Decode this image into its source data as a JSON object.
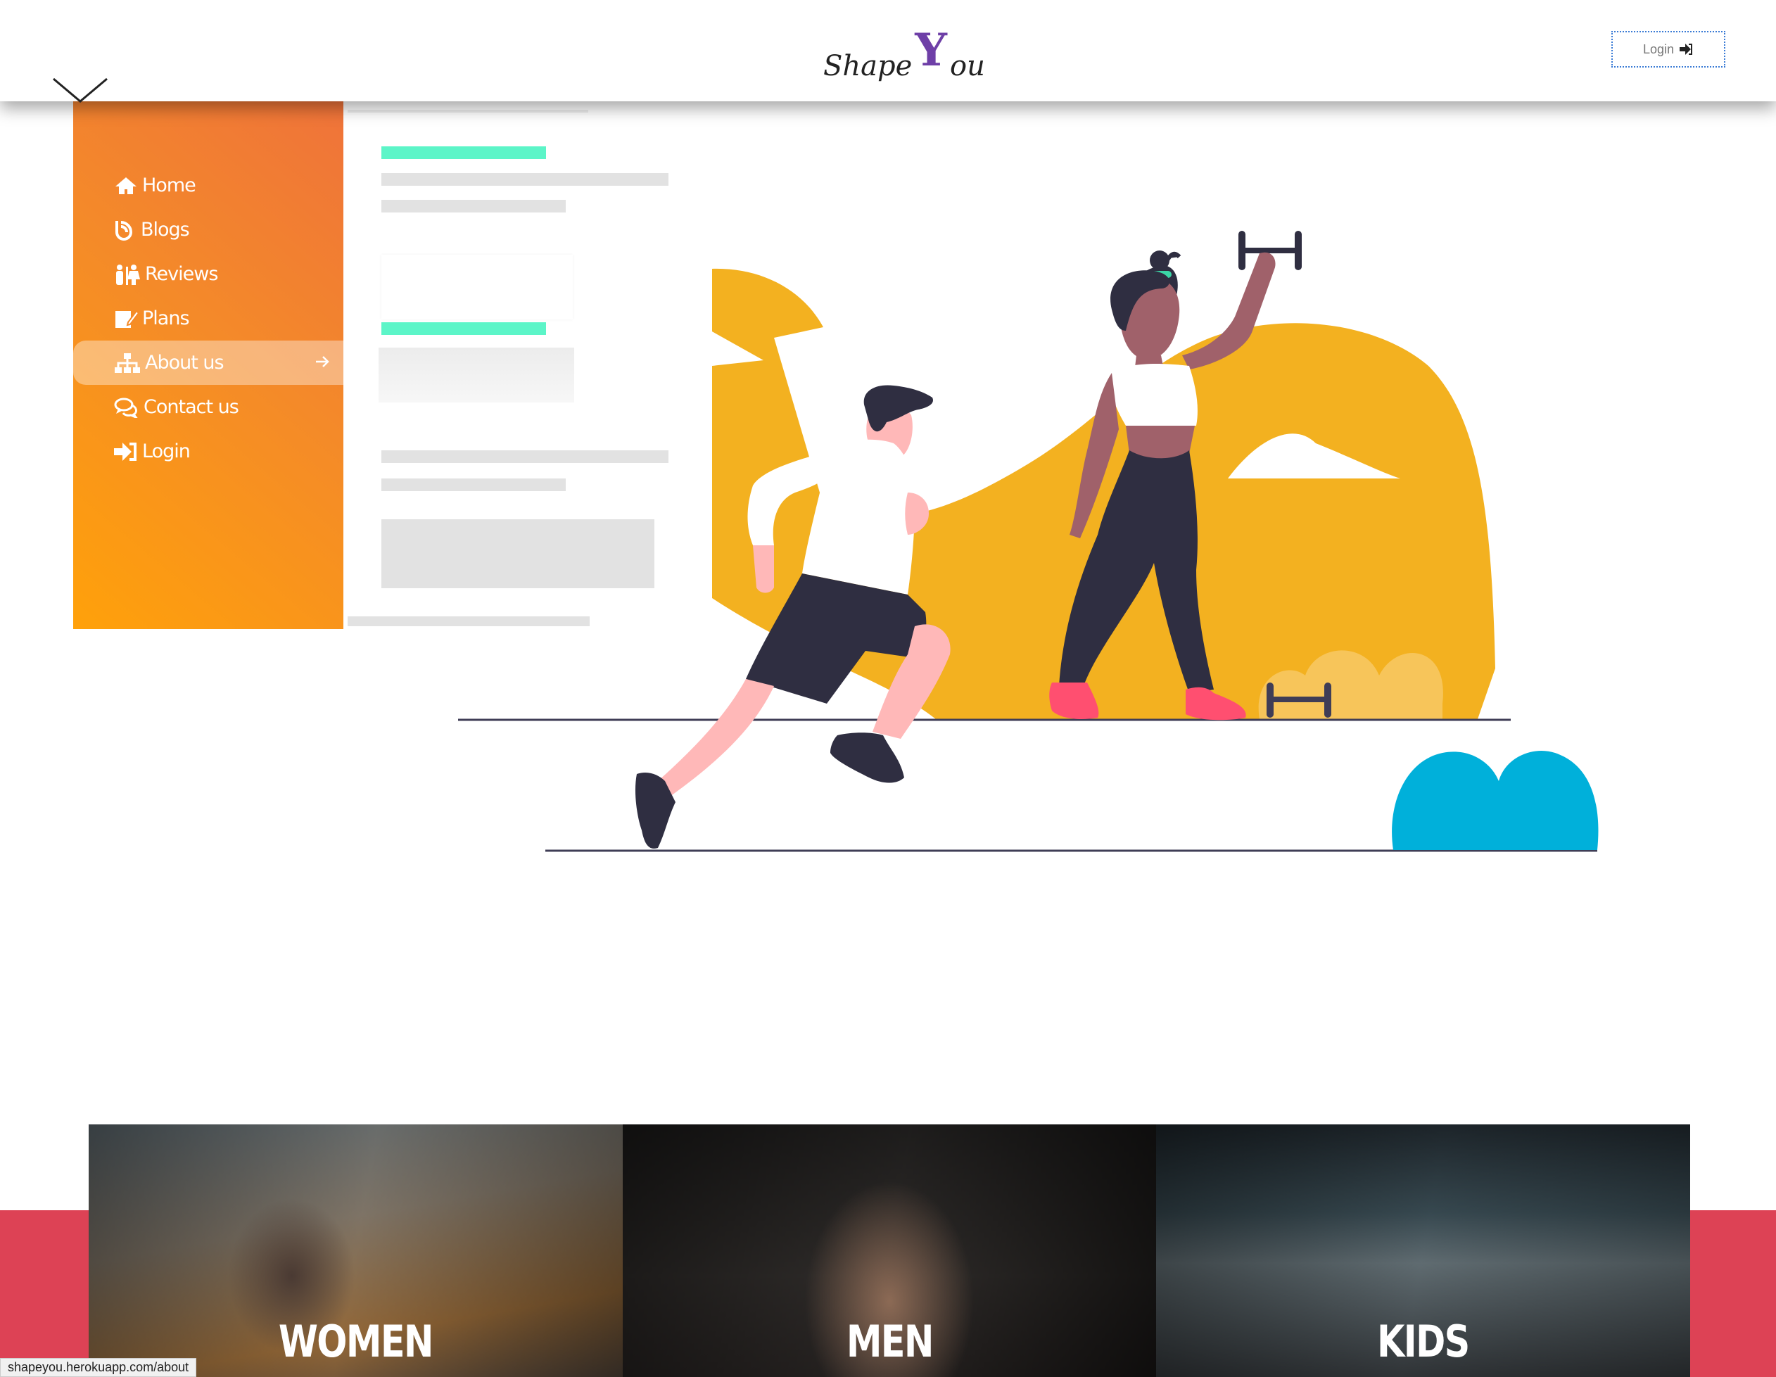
{
  "header": {
    "logo": {
      "part1": "Shape",
      "part2": "Y",
      "part3": "ou"
    },
    "login_label": "Login"
  },
  "menu": {
    "items": [
      {
        "label": "Home",
        "icon": "home-icon"
      },
      {
        "label": "Blogs",
        "icon": "blogger-icon"
      },
      {
        "label": "Reviews",
        "icon": "people-icon"
      },
      {
        "label": "Plans",
        "icon": "edit-icon"
      },
      {
        "label": "About us",
        "icon": "sitemap-icon",
        "active": true
      },
      {
        "label": "Contact us",
        "icon": "comments-icon"
      },
      {
        "label": "Login",
        "icon": "sign-in-icon"
      }
    ]
  },
  "cards": [
    {
      "title": "WOMEN"
    },
    {
      "title": "MEN"
    },
    {
      "title": "KIDS"
    }
  ],
  "status_url": "shapeyou.herokuapp.com/about",
  "colors": {
    "menu_gradient_start": "#ffa10a",
    "menu_gradient_end": "#ef733a",
    "illustration_yellow": "#f3b120",
    "bush_blue": "#00b0da",
    "band_red": "#dd4255",
    "skeleton_accent": "#5cf5c8",
    "logo_purple": "#6e3fa7"
  }
}
